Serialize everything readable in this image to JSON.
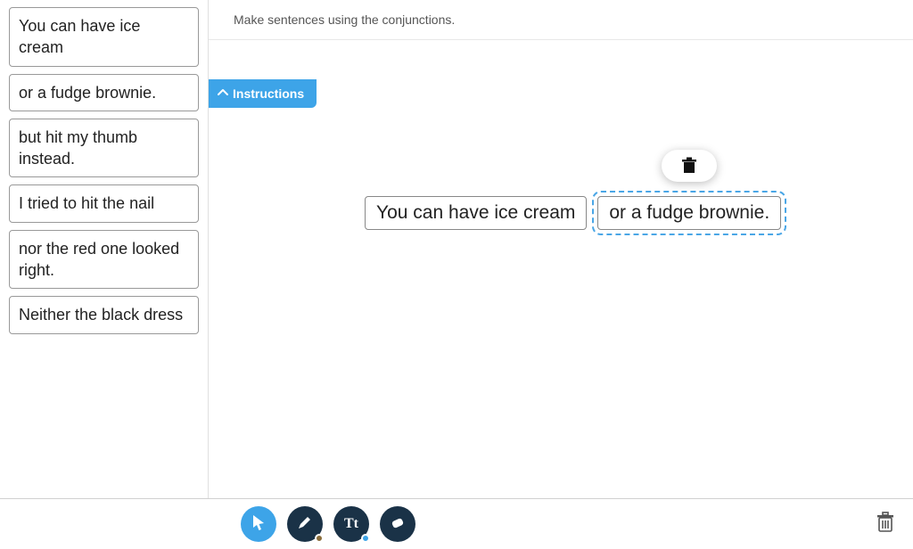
{
  "instruction": "Make sentences using the conjunctions.",
  "instructions_tab": "Instructions",
  "sidebar": {
    "items": [
      "You can have ice cream",
      "or a fudge brownie.",
      "but hit my thumb instead.",
      "I tried to hit the nail",
      "nor the red one looked right.",
      "Neither the black dress"
    ]
  },
  "canvas": {
    "placed": [
      {
        "text": "You can have ice cream",
        "selected": false
      },
      {
        "text": "or a fudge brownie.",
        "selected": true
      }
    ]
  },
  "tools": {
    "pointer": "pointer",
    "pencil": "pencil",
    "text": "Tt",
    "eraser": "eraser"
  }
}
